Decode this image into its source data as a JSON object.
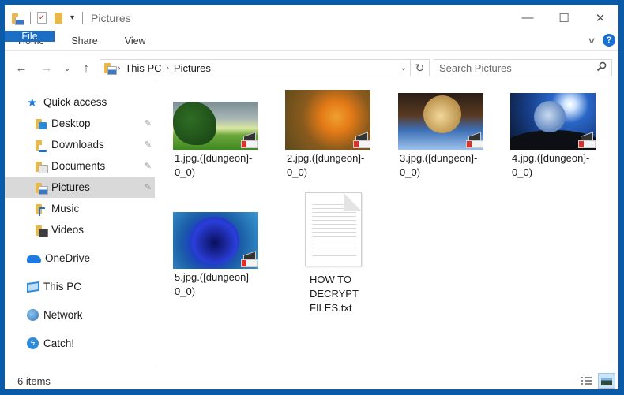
{
  "window": {
    "title": "Pictures",
    "controls": {
      "minimize": "—",
      "maximize": "☐",
      "close": "✕"
    }
  },
  "quick_access_toolbar": {
    "icons": [
      "folder-properties-icon",
      "checkmark-doc-icon",
      "new-folder-icon",
      "customize-dropdown-icon"
    ],
    "dropdown_glyph": "▾"
  },
  "ribbon": {
    "tabs": [
      {
        "label": "File",
        "active": true
      },
      {
        "label": "Home"
      },
      {
        "label": "Share"
      },
      {
        "label": "View"
      }
    ],
    "expand_glyph": "∨",
    "help_glyph": "?"
  },
  "navigation": {
    "back_glyph": "←",
    "forward_glyph": "→",
    "recent_glyph": "⌄",
    "up_glyph": "↑",
    "breadcrumb": [
      "This PC",
      "Pictures"
    ],
    "separator_glyph": "›",
    "dropdown_glyph": "⌄",
    "refresh_glyph": "↻",
    "search_placeholder": "Search Pictures",
    "search_glyph": "⚲"
  },
  "sidebar": {
    "quick_access": {
      "label": "Quick access",
      "items": [
        {
          "label": "Desktop",
          "pinned": true
        },
        {
          "label": "Downloads",
          "pinned": true
        },
        {
          "label": "Documents",
          "pinned": true
        },
        {
          "label": "Pictures",
          "pinned": true,
          "selected": true
        },
        {
          "label": "Music",
          "pinned": false
        },
        {
          "label": "Videos",
          "pinned": false
        }
      ]
    },
    "locations": [
      {
        "label": "OneDrive"
      },
      {
        "label": "This PC"
      },
      {
        "label": "Network"
      },
      {
        "label": "Catch!"
      }
    ],
    "pin_glyph": "📌"
  },
  "files": [
    {
      "name_line1": "1.jpg.([dungeon]-",
      "name_line2": "0_0)",
      "type": "encrypted-image"
    },
    {
      "name_line1": "2.jpg.([dungeon]-",
      "name_line2": "0_0)",
      "type": "encrypted-image"
    },
    {
      "name_line1": "3.jpg.([dungeon]-",
      "name_line2": "0_0)",
      "type": "encrypted-image"
    },
    {
      "name_line1": "4.jpg.([dungeon]-",
      "name_line2": "0_0)",
      "type": "encrypted-image"
    },
    {
      "name_line1": "5.jpg.([dungeon]-",
      "name_line2": "0_0)",
      "type": "encrypted-image"
    },
    {
      "name_line1": "HOW TO",
      "name_line2": "DECRYPT",
      "name_line3": "FILES.txt",
      "type": "text-document"
    }
  ],
  "status": {
    "item_count": "6 items"
  },
  "colors": {
    "window_border": "#0b5aa8",
    "file_tab": "#1c6ec4",
    "selected_item": "#d9d9d9",
    "help_badge": "#1a6fd0"
  }
}
